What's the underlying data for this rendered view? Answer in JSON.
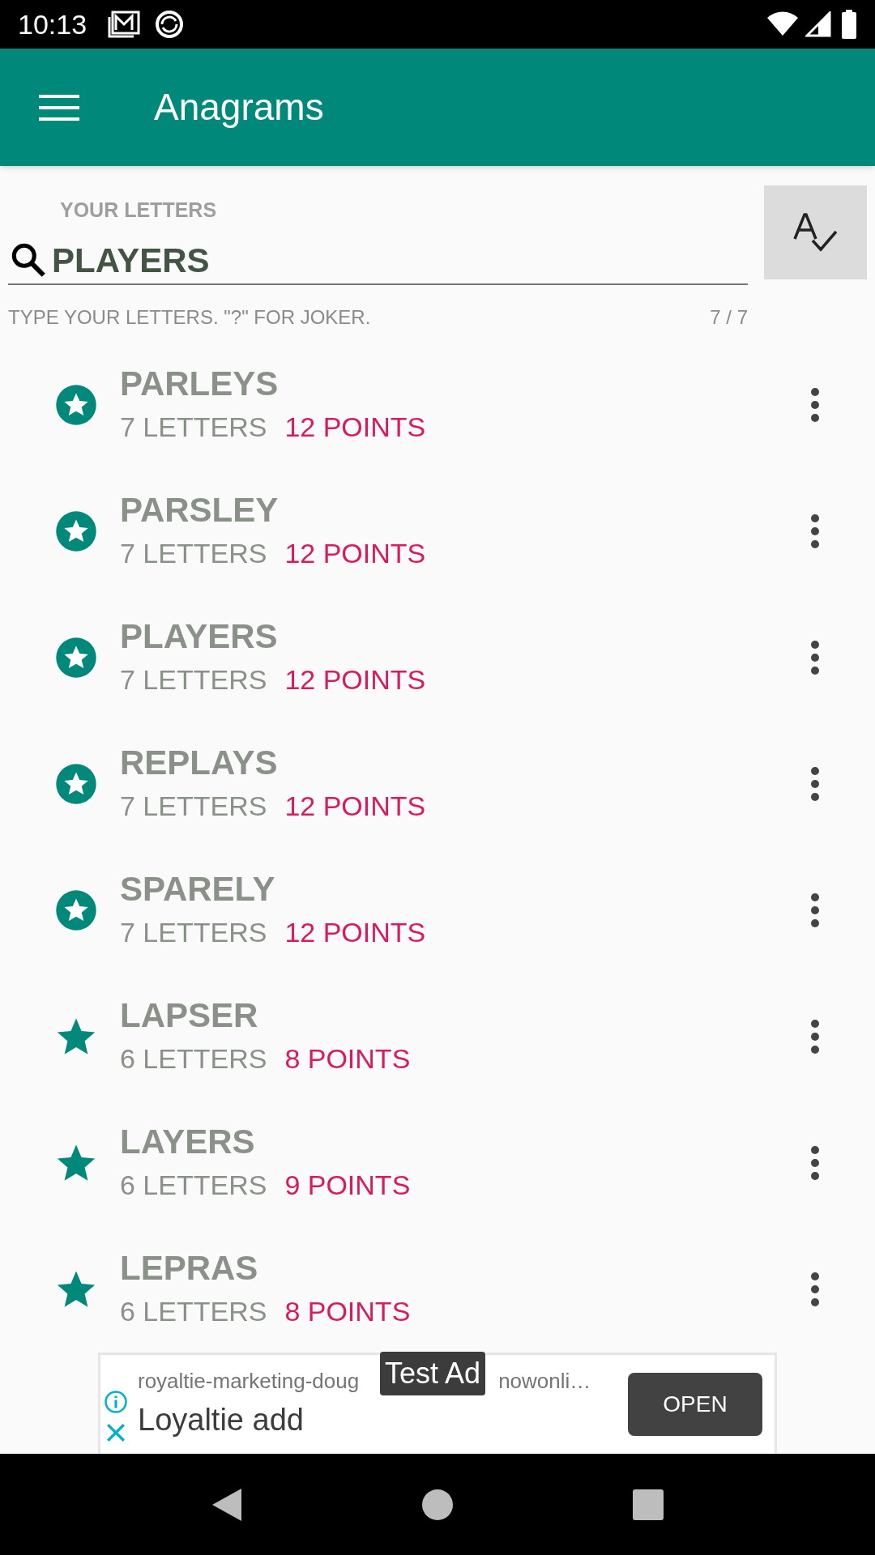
{
  "status_bar": {
    "time": "10:13"
  },
  "toolbar": {
    "title": "Anagrams"
  },
  "letters": {
    "label": "YOUR LETTERS",
    "value": "PLAYERS",
    "helper": "TYPE YOUR LETTERS. \"?\" FOR JOKER.",
    "counter": "7 / 7"
  },
  "words": [
    {
      "word": "PARLEYS",
      "letters": "7 LETTERS",
      "points": "12 POINTS",
      "kind": "circled"
    },
    {
      "word": "PARSLEY",
      "letters": "7 LETTERS",
      "points": "12 POINTS",
      "kind": "circled"
    },
    {
      "word": "PLAYERS",
      "letters": "7 LETTERS",
      "points": "12 POINTS",
      "kind": "circled"
    },
    {
      "word": "REPLAYS",
      "letters": "7 LETTERS",
      "points": "12 POINTS",
      "kind": "circled"
    },
    {
      "word": "SPARELY",
      "letters": "7 LETTERS",
      "points": "12 POINTS",
      "kind": "circled"
    },
    {
      "word": "LAPSER",
      "letters": "6 LETTERS",
      "points": "8 POINTS",
      "kind": "plain"
    },
    {
      "word": "LAYERS",
      "letters": "6 LETTERS",
      "points": "9 POINTS",
      "kind": "plain"
    },
    {
      "word": "LEPRAS",
      "letters": "6 LETTERS",
      "points": "8 POINTS",
      "kind": "plain"
    }
  ],
  "ad": {
    "badge": "Test Ad",
    "url_start": "royaltie-marketing-doug",
    "url_end": "nowonli…",
    "title": "Loyaltie add",
    "button": "OPEN"
  }
}
